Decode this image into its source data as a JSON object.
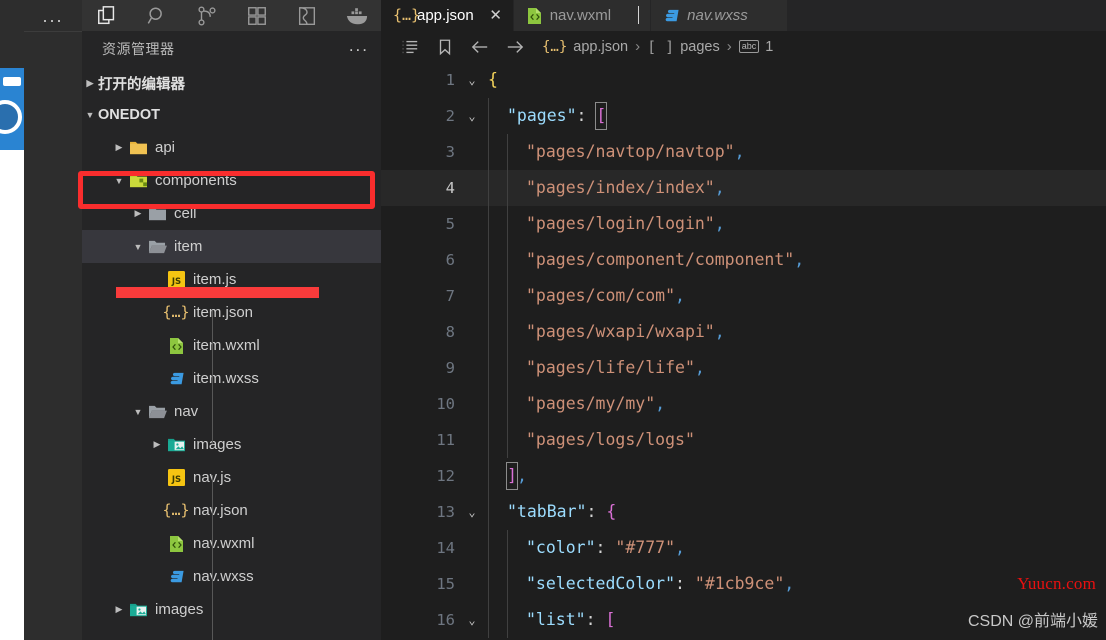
{
  "window": {
    "theme_bg": "#1e1e1e",
    "sidebar_bg": "#252526",
    "accent_red": "#f92d2d"
  },
  "activity_bar": {
    "overflow_label": "...",
    "icons": [
      {
        "name": "explorer-icon",
        "label": "Explorer",
        "active": true
      },
      {
        "name": "search-icon",
        "label": "Search",
        "active": false
      },
      {
        "name": "source-control-icon",
        "label": "Source Control",
        "active": false
      },
      {
        "name": "extensions-icon",
        "label": "Extensions",
        "active": false
      },
      {
        "name": "remote-explorer-icon",
        "label": "Remote Explorer",
        "active": false
      },
      {
        "name": "docker-icon",
        "label": "Docker",
        "active": false
      }
    ]
  },
  "sidebar": {
    "title": "资源管理器",
    "more_actions": "...",
    "sections": [
      {
        "label": "打开的编辑器",
        "expanded": false
      },
      {
        "label": "ONEDOT",
        "expanded": true
      }
    ],
    "tree": [
      {
        "label": "api",
        "kind": "folder-api",
        "depth": 1,
        "expanded": false,
        "selected": false
      },
      {
        "label": "components",
        "kind": "folder-components",
        "depth": 1,
        "expanded": true,
        "selected": false
      },
      {
        "label": "cell",
        "kind": "folder",
        "depth": 2,
        "expanded": false,
        "selected": false
      },
      {
        "label": "item",
        "kind": "folder-open",
        "depth": 2,
        "expanded": true,
        "selected": true
      },
      {
        "label": "item.js",
        "kind": "js",
        "depth": 3,
        "expanded": null,
        "selected": false
      },
      {
        "label": "item.json",
        "kind": "json",
        "depth": 3,
        "expanded": null,
        "selected": false
      },
      {
        "label": "item.wxml",
        "kind": "wxml",
        "depth": 3,
        "expanded": null,
        "selected": false
      },
      {
        "label": "item.wxss",
        "kind": "wxss",
        "depth": 3,
        "expanded": null,
        "selected": false
      },
      {
        "label": "nav",
        "kind": "folder-open",
        "depth": 2,
        "expanded": true,
        "selected": false
      },
      {
        "label": "images",
        "kind": "folder-images",
        "depth": 3,
        "expanded": false,
        "selected": false
      },
      {
        "label": "nav.js",
        "kind": "js",
        "depth": 3,
        "expanded": null,
        "selected": false
      },
      {
        "label": "nav.json",
        "kind": "json",
        "depth": 3,
        "expanded": null,
        "selected": false
      },
      {
        "label": "nav.wxml",
        "kind": "wxml",
        "depth": 3,
        "expanded": null,
        "selected": false
      },
      {
        "label": "nav.wxss",
        "kind": "wxss",
        "depth": 3,
        "expanded": null,
        "selected": false
      },
      {
        "label": "images",
        "kind": "folder-images",
        "depth": 1,
        "expanded": false,
        "selected": false
      }
    ]
  },
  "annotations": [
    {
      "name": "components-highlight-box",
      "type": "box",
      "color": "#f92d2d"
    },
    {
      "name": "itemjs-highlight-bar",
      "type": "bar",
      "color": "#f93b3b"
    }
  ],
  "tabs": [
    {
      "label": "app.json",
      "icon": "json-icon",
      "active": true,
      "preview": false,
      "close": "✕"
    },
    {
      "label": "nav.wxml",
      "icon": "wxml-icon",
      "active": false,
      "preview": false,
      "close": ""
    },
    {
      "label": "nav.wxss",
      "icon": "wxss-icon",
      "active": false,
      "preview": true,
      "close": ""
    }
  ],
  "breadcrumb": {
    "icons": [
      "outline-icon",
      "bookmark-icon",
      "back-arrow-icon",
      "forward-arrow-icon"
    ],
    "crumbs": [
      {
        "label": "app.json",
        "icon": "json-icon"
      },
      {
        "label": "pages",
        "icon": "array-icon"
      },
      {
        "label": "1",
        "icon": "string-icon"
      }
    ],
    "separator": "›"
  },
  "editor": {
    "filename": "app.json",
    "current_line": 4,
    "lines": [
      {
        "n": 1,
        "fold": "⌄",
        "indent": 0,
        "tokens": [
          {
            "t": "{",
            "c": "k-brace"
          }
        ]
      },
      {
        "n": 2,
        "fold": "⌄",
        "indent": 1,
        "tokens": [
          {
            "t": "\"pages\"",
            "c": "k-key-top"
          },
          {
            "t": ":",
            "c": "k-punc"
          },
          {
            "t": " ",
            "c": "k-punc"
          },
          {
            "t": "[",
            "c": "k-brace2",
            "box": true
          }
        ]
      },
      {
        "n": 3,
        "fold": "",
        "indent": 2,
        "tokens": [
          {
            "t": "\"pages/navtop/navtop\"",
            "c": "k-str"
          },
          {
            "t": ",",
            "c": "k-comma"
          }
        ]
      },
      {
        "n": 4,
        "fold": "",
        "indent": 2,
        "tokens": [
          {
            "t": "\"pages/index/index\"",
            "c": "k-str"
          },
          {
            "t": ",",
            "c": "k-comma"
          }
        ]
      },
      {
        "n": 5,
        "fold": "",
        "indent": 2,
        "tokens": [
          {
            "t": "\"pages/login/login\"",
            "c": "k-str"
          },
          {
            "t": ",",
            "c": "k-comma"
          }
        ]
      },
      {
        "n": 6,
        "fold": "",
        "indent": 2,
        "tokens": [
          {
            "t": "\"pages/component/component\"",
            "c": "k-str"
          },
          {
            "t": ",",
            "c": "k-comma"
          }
        ]
      },
      {
        "n": 7,
        "fold": "",
        "indent": 2,
        "tokens": [
          {
            "t": "\"pages/com/com\"",
            "c": "k-str"
          },
          {
            "t": ",",
            "c": "k-comma"
          }
        ]
      },
      {
        "n": 8,
        "fold": "",
        "indent": 2,
        "tokens": [
          {
            "t": "\"pages/wxapi/wxapi\"",
            "c": "k-str"
          },
          {
            "t": ",",
            "c": "k-comma"
          }
        ]
      },
      {
        "n": 9,
        "fold": "",
        "indent": 2,
        "tokens": [
          {
            "t": "\"pages/life/life\"",
            "c": "k-str"
          },
          {
            "t": ",",
            "c": "k-comma"
          }
        ]
      },
      {
        "n": 10,
        "fold": "",
        "indent": 2,
        "tokens": [
          {
            "t": "\"pages/my/my\"",
            "c": "k-str"
          },
          {
            "t": ",",
            "c": "k-comma"
          }
        ]
      },
      {
        "n": 11,
        "fold": "",
        "indent": 2,
        "tokens": [
          {
            "t": "\"pages/logs/logs\"",
            "c": "k-str"
          }
        ]
      },
      {
        "n": 12,
        "fold": "",
        "indent": 1,
        "tokens": [
          {
            "t": "]",
            "c": "k-brace2",
            "box": true
          },
          {
            "t": ",",
            "c": "k-comma"
          }
        ]
      },
      {
        "n": 13,
        "fold": "⌄",
        "indent": 1,
        "tokens": [
          {
            "t": "\"tabBar\"",
            "c": "k-key-top"
          },
          {
            "t": ":",
            "c": "k-punc"
          },
          {
            "t": " ",
            "c": "k-punc"
          },
          {
            "t": "{",
            "c": "k-brace2"
          }
        ]
      },
      {
        "n": 14,
        "fold": "",
        "indent": 2,
        "tokens": [
          {
            "t": "\"color\"",
            "c": "k-key"
          },
          {
            "t": ":",
            "c": "k-punc"
          },
          {
            "t": " ",
            "c": "k-punc"
          },
          {
            "t": "\"#777\"",
            "c": "k-str"
          },
          {
            "t": ",",
            "c": "k-comma"
          }
        ]
      },
      {
        "n": 15,
        "fold": "",
        "indent": 2,
        "tokens": [
          {
            "t": "\"selectedColor\"",
            "c": "k-key"
          },
          {
            "t": ":",
            "c": "k-punc"
          },
          {
            "t": " ",
            "c": "k-punc"
          },
          {
            "t": "\"#1cb9ce\"",
            "c": "k-str"
          },
          {
            "t": ",",
            "c": "k-comma"
          }
        ]
      },
      {
        "n": 16,
        "fold": "⌄",
        "indent": 2,
        "tokens": [
          {
            "t": "\"list\"",
            "c": "k-key"
          },
          {
            "t": ":",
            "c": "k-punc"
          },
          {
            "t": " ",
            "c": "k-punc"
          },
          {
            "t": "[",
            "c": "k-brace2"
          }
        ]
      }
    ]
  },
  "watermarks": {
    "site": "Yuucn.com",
    "author": "CSDN @前端小媛"
  }
}
